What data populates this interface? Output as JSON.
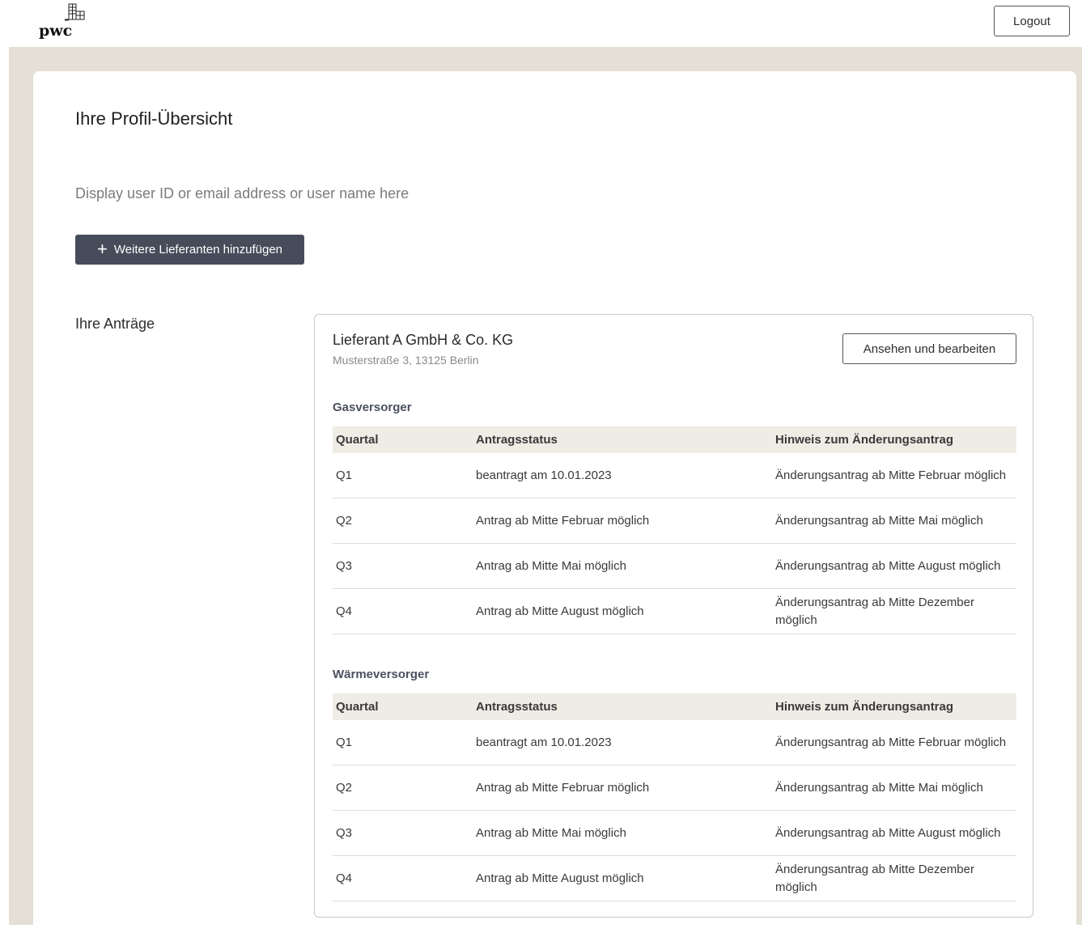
{
  "header": {
    "logo_text": "pwc",
    "logout_label": "Logout"
  },
  "page": {
    "title": "Ihre Profil-Übersicht",
    "user_id_placeholder": "Display user ID or email address or user name here",
    "add_button_label": "Weitere Lieferanten hinzufügen",
    "applications_label": "Ihre Anträge"
  },
  "supplier": {
    "name": "Lieferant A GmbH & Co. KG",
    "address": "Musterstraße 3, 13125 Berlin",
    "edit_button_label": "Ansehen und bearbeiten",
    "groups": [
      {
        "title": "Gasversorger",
        "columns": [
          "Quartal",
          "Antragsstatus",
          "Hinweis zum Änderungsantrag"
        ],
        "rows": [
          [
            "Q1",
            "beantragt am 10.01.2023",
            "Änderungsantrag ab Mitte Februar möglich"
          ],
          [
            "Q2",
            "Antrag ab Mitte Februar möglich",
            "Änderungsantrag ab Mitte Mai möglich"
          ],
          [
            "Q3",
            "Antrag ab Mitte Mai möglich",
            "Änderungsantrag ab Mitte August möglich"
          ],
          [
            "Q4",
            "Antrag ab Mitte August möglich",
            "Änderungsantrag ab Mitte Dezember möglich"
          ]
        ]
      },
      {
        "title": "Wärmeversorger",
        "columns": [
          "Quartal",
          "Antragsstatus",
          "Hinweis zum Änderungsantrag"
        ],
        "rows": [
          [
            "Q1",
            "beantragt am 10.01.2023",
            "Änderungsantrag ab Mitte Februar möglich"
          ],
          [
            "Q2",
            "Antrag ab Mitte Februar möglich",
            "Änderungsantrag ab Mitte Mai möglich"
          ],
          [
            "Q3",
            "Antrag ab Mitte Mai möglich",
            "Änderungsantrag ab Mitte August möglich"
          ],
          [
            "Q4",
            "Antrag ab Mitte August möglich",
            "Änderungsantrag ab Mitte Dezember möglich"
          ]
        ]
      }
    ]
  },
  "colors": {
    "page_background": "#e4e0d5",
    "primary_button": "#464c5a",
    "table_header": "#efece6",
    "group_title": "#4b5161"
  }
}
